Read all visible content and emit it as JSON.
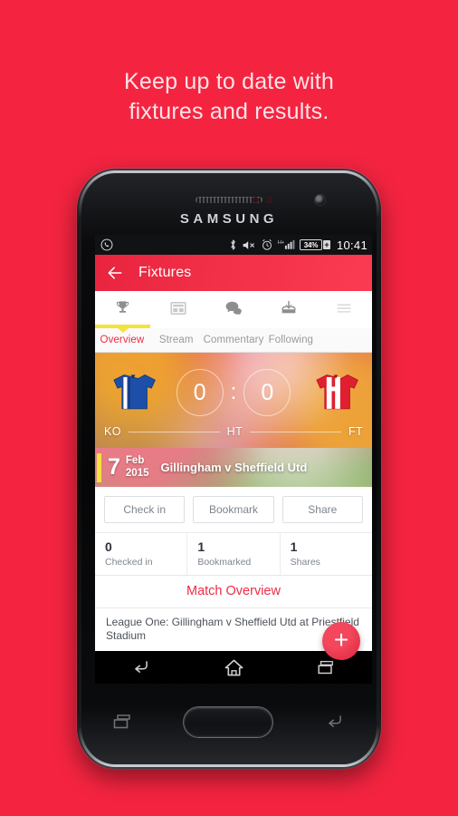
{
  "promo": {
    "line1": "Keep up to date with",
    "line2": "fixtures and results.",
    "background_color": "#f42440",
    "text_color": "#ffe3e8"
  },
  "device": {
    "brand": "SAMSUNG",
    "hardware_keys": [
      "recents-key",
      "home-button",
      "back-key"
    ]
  },
  "status_bar": {
    "left_icons": [
      "whatsapp-icon"
    ],
    "right_icons": [
      "bluetooth-icon",
      "volume-mute-icon",
      "alarm-clock-icon",
      "hsplus-signal-icon"
    ],
    "network_type": "H+",
    "battery_percent": "34%",
    "battery_state": "charging",
    "clock": "10:41"
  },
  "action_bar": {
    "back_icon": "arrow-left-icon",
    "title": "Fixtures",
    "color": "#f23047"
  },
  "tabs": {
    "items": [
      {
        "icon": "trophy-icon",
        "label": "Overview",
        "active": true
      },
      {
        "icon": "newspaper-icon",
        "label": "Stream",
        "active": false
      },
      {
        "icon": "chat-bubbles-icon",
        "label": "Commentary",
        "active": false
      },
      {
        "icon": "inbox-download-icon",
        "label": "Following",
        "active": false
      },
      {
        "icon": "hamburger-menu-icon",
        "label": "",
        "active": false
      }
    ],
    "active_color": "#ef2b43",
    "indicator_color": "#f5e23c",
    "inactive_color": "#9a9a9a"
  },
  "match": {
    "home_kit": "blue-white-stripe-shirt",
    "away_kit": "red-white-stripe-shirt",
    "home_score": "0",
    "away_score": "0",
    "score_separator": ":",
    "timeline": {
      "start": "KO",
      "middle": "HT",
      "end": "FT"
    },
    "date_day": "7",
    "date_month": "Feb",
    "date_year": "2015",
    "title": "Gillingham v Sheffield Utd"
  },
  "actions": {
    "check_in": "Check in",
    "bookmark": "Bookmark",
    "share": "Share"
  },
  "stats": [
    {
      "value": "0",
      "label": "Checked in"
    },
    {
      "value": "1",
      "label": "Bookmarked"
    },
    {
      "value": "1",
      "label": "Shares"
    }
  ],
  "overview": {
    "heading": "Match Overview",
    "body": "League One: Gillingham v Sheffield Utd at Priestfield Stadium",
    "fab_icon": "plus-icon",
    "fab_color": "#e0213a"
  },
  "nav_bar": {
    "buttons": [
      "back-nav-icon",
      "home-nav-icon",
      "recents-nav-icon"
    ]
  }
}
